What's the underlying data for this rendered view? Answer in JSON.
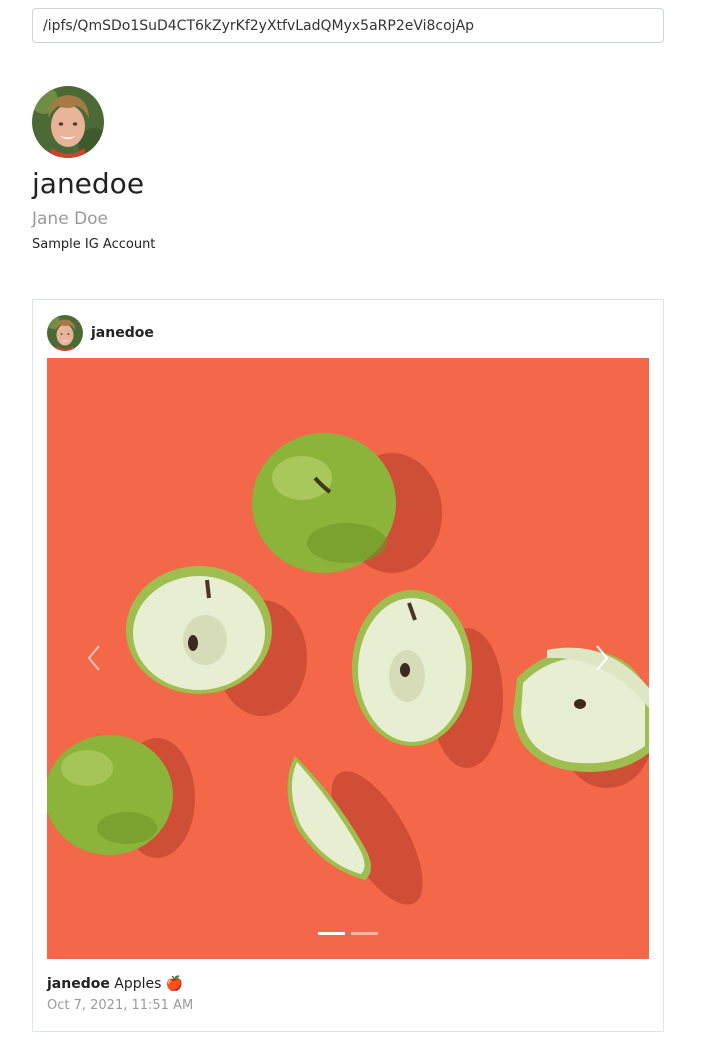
{
  "address_bar": {
    "value": "/ipfs/QmSDo1SuD4CT6kZyrKf2yXtfvLadQMyx5aRP2eVi8cojAp"
  },
  "profile": {
    "avatar_icon": "avatar",
    "username": "janedoe",
    "full_name": "Jane Doe",
    "bio": "Sample IG Account"
  },
  "post": {
    "username": "janedoe",
    "image_description_icon": "apples-photo",
    "carousel": {
      "prev_icon": "chevron-left-icon",
      "next_icon": "chevron-right-icon",
      "slide_count": 2,
      "active_slide": 1
    },
    "caption_user": "janedoe",
    "caption_text": "Apples 🍎",
    "timestamp": "Oct 7, 2021, 11:51 AM"
  },
  "colors": {
    "photo_background": "#f26849",
    "muted_text": "#9a9a9a",
    "apple_green": "#8cb33a"
  }
}
